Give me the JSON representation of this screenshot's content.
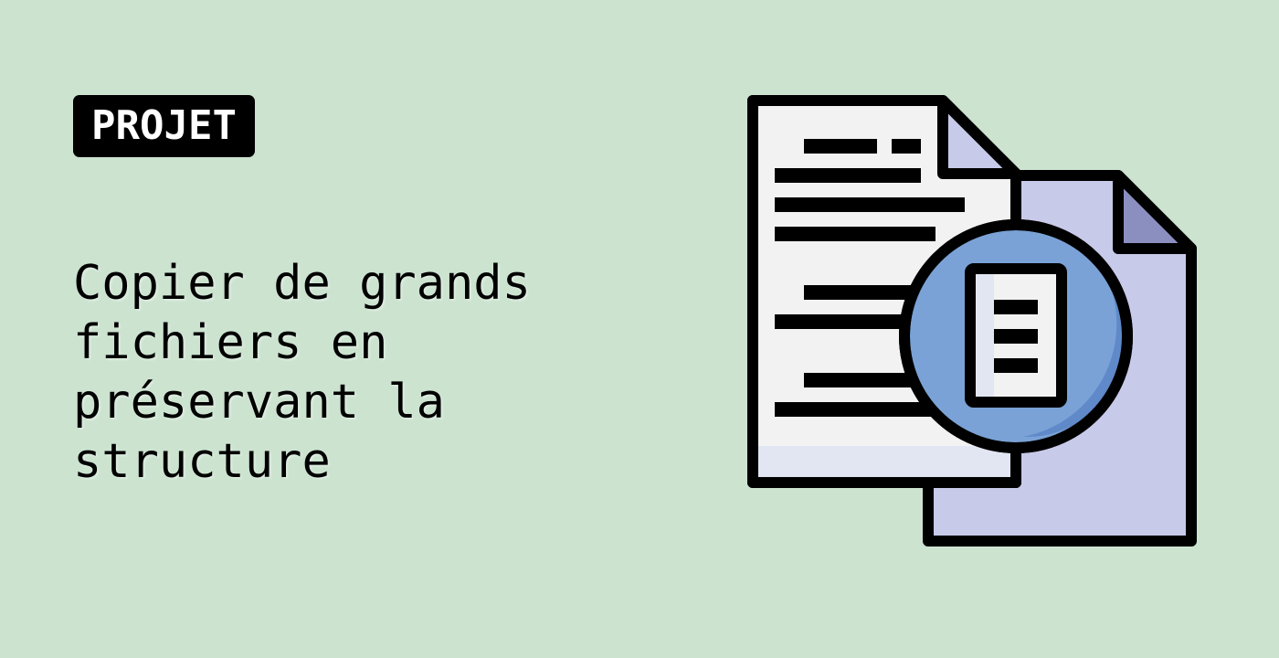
{
  "badge": {
    "label": "PROJET"
  },
  "title": {
    "lines": [
      "Copier de grands",
      "fichiers en",
      "préservant la",
      "structure"
    ]
  },
  "illustration": {
    "icon": "documents-magnifier-icon",
    "colors": {
      "background": "#cce3d0",
      "outline": "#000000",
      "front_page": "#f2f2f2",
      "front_page_shade": "#e1e6f2",
      "back_page": "#c8caea",
      "back_corner": "#8b8fc0",
      "lens": "#7aa2d6",
      "lens_shade": "#5f89c8"
    }
  }
}
